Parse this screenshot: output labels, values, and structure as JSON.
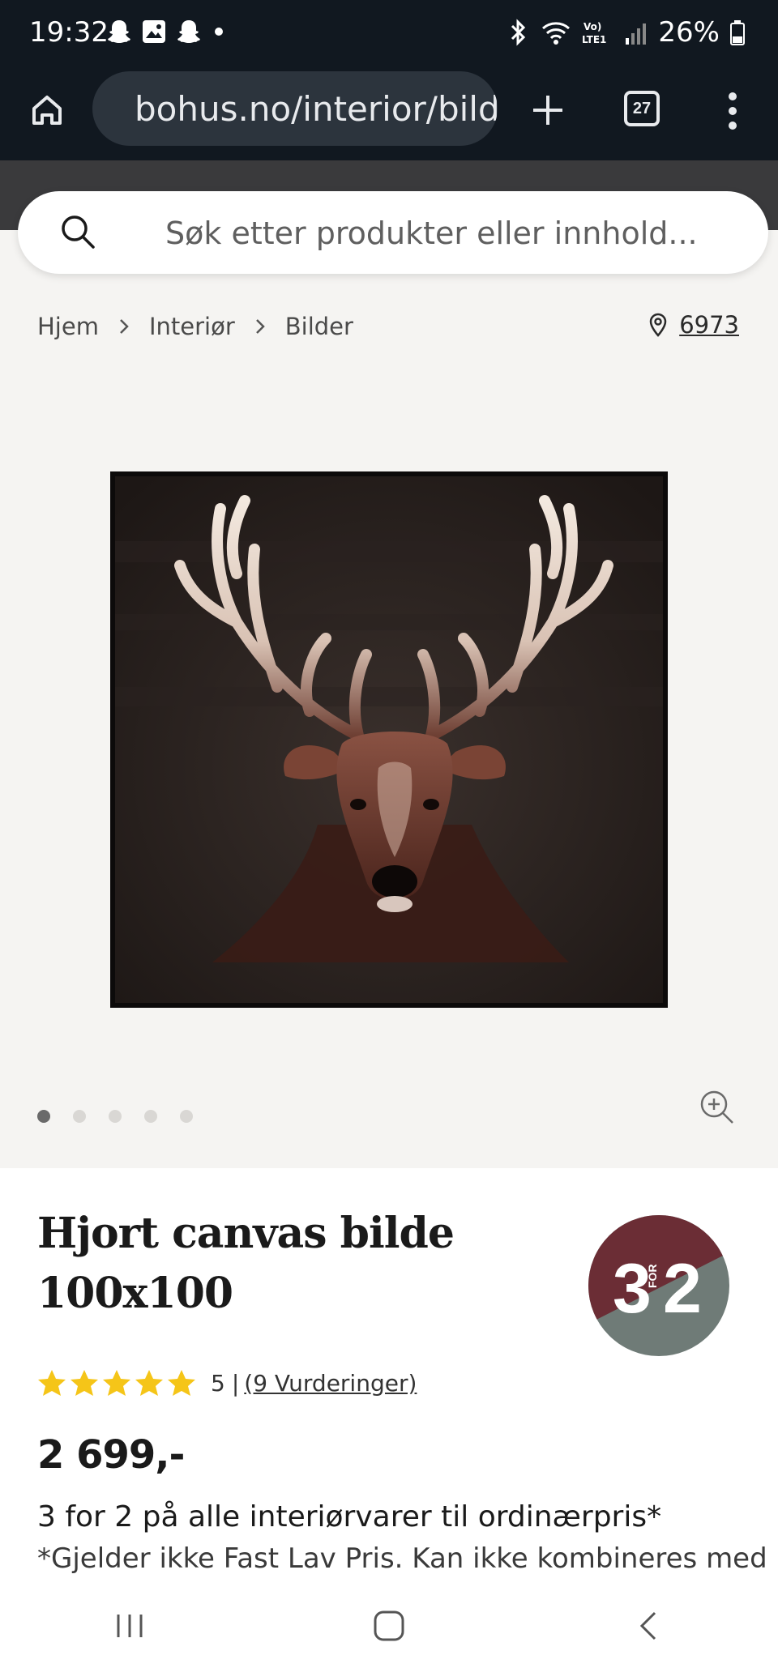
{
  "status_bar": {
    "time": "19:32",
    "battery": "26%",
    "network": "LTE1"
  },
  "browser": {
    "url": "bohus.no/interior/bilde",
    "tab_count": "27"
  },
  "search": {
    "placeholder": "Søk etter produkter eller innhold..."
  },
  "breadcrumb": {
    "items": [
      "Hjem",
      "Interiør",
      "Bilder"
    ],
    "store_number": "6973"
  },
  "gallery": {
    "image_count": 5,
    "active_index": 0
  },
  "product": {
    "title_line1": "Hjort canvas bilde",
    "title_line2": "100x100",
    "badge": {
      "big_left": "3",
      "small": "FOR",
      "big_right": "2",
      "color_top": "#6b2d35",
      "color_bottom": "#6f7b77"
    },
    "rating_value": "5",
    "rating_separator": "|",
    "rating_count": "(9 Vurderinger)",
    "stars": 5,
    "price": "2 699,-",
    "promo_title": "3 for 2 på alle interiørvarer til ordinærpris*",
    "promo_note": "*Gjelder ikke Fast Lav Pris. Kan ikke kombineres med"
  },
  "colors": {
    "star": "#f5c518",
    "browser_bg": "#111820"
  }
}
